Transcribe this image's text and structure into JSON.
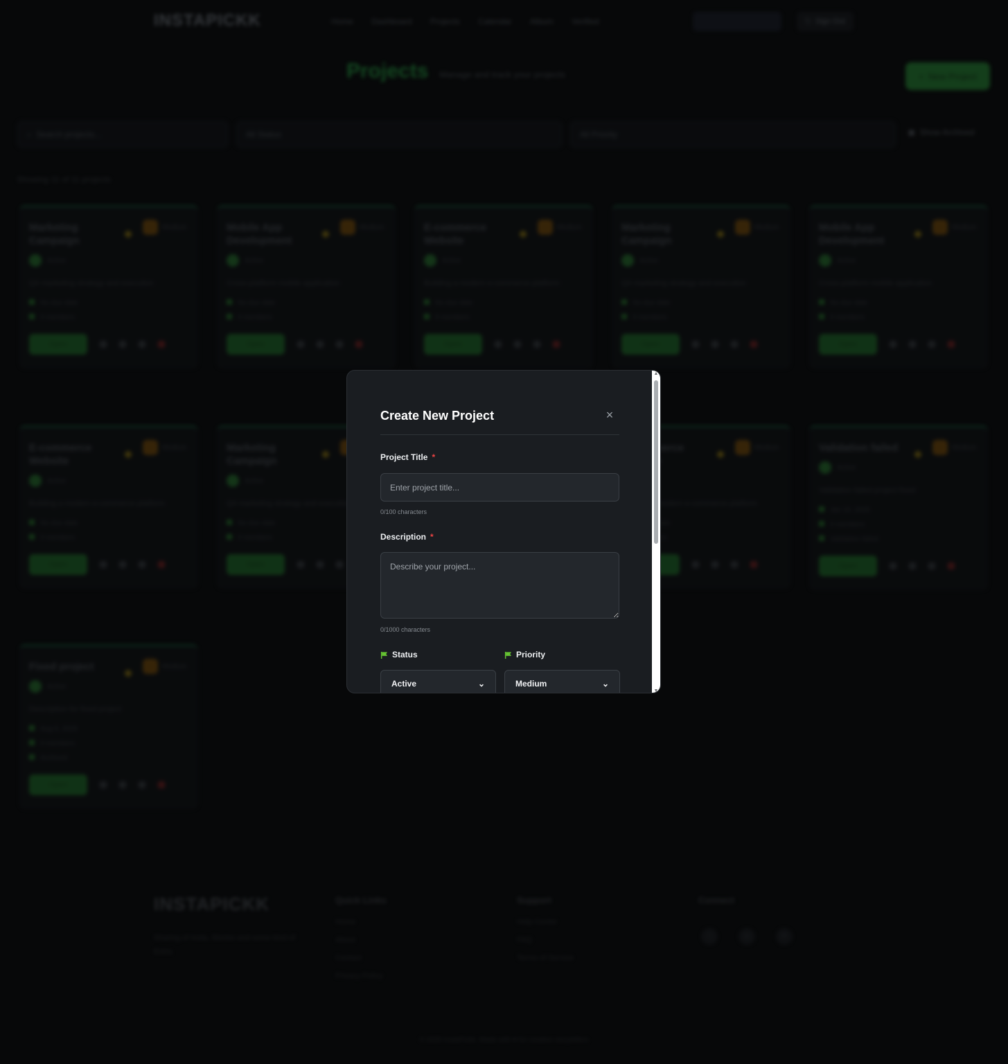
{
  "nav": {
    "logo": "INSTAPICKK",
    "links": [
      "Home",
      "Dashboard",
      "Projects",
      "Calendar",
      "Album",
      "Verified"
    ],
    "signout": "Sign Out"
  },
  "header": {
    "title": "Projects",
    "subtitle": "Manage and track your projects",
    "new_button": "New Project"
  },
  "filters": {
    "search_placeholder": "Search projects...",
    "status": "All Status",
    "priority": "All Priority",
    "archived": "Show Archived"
  },
  "showing": "Showing 11 of 11 projects",
  "cards": [
    {
      "title": "Marketing Campaign",
      "priority": "Medium",
      "status": "Active",
      "desc": "Q4 marketing strategy and execution",
      "meta": [
        "No due date",
        "0 members"
      ],
      "open": "Open"
    },
    {
      "title": "Mobile App Development",
      "priority": "Medium",
      "status": "Active",
      "desc": "Cross-platform mobile application",
      "meta": [
        "No due date",
        "0 members"
      ],
      "open": "Open"
    },
    {
      "title": "E-commerce Website",
      "priority": "Medium",
      "status": "Active",
      "desc": "Building a modern e-commerce platform",
      "meta": [
        "No due date",
        "0 members"
      ],
      "open": "Open"
    },
    {
      "title": "Marketing Campaign",
      "priority": "Medium",
      "status": "Active",
      "desc": "Q4 marketing strategy and execution",
      "meta": [
        "No due date",
        "0 members"
      ],
      "open": "Open"
    },
    {
      "title": "Mobile App Development",
      "priority": "Medium",
      "status": "Active",
      "desc": "Cross-platform mobile application",
      "meta": [
        "No due date",
        "0 members"
      ],
      "open": "Open"
    },
    {
      "title": "E-commerce Website",
      "priority": "Medium",
      "status": "Active",
      "desc": "Building a modern e-commerce platform",
      "meta": [
        "No due date",
        "0 members"
      ],
      "open": "Open"
    },
    {
      "title": "Marketing Campaign",
      "priority": "Medium",
      "status": "Active",
      "desc": "Q4 marketing strategy and execution",
      "meta": [
        "No due date",
        "0 members"
      ],
      "open": "Open"
    },
    {
      "title": "E-commerce Website",
      "priority": "Medium",
      "status": "Active",
      "desc": "Building a modern e-commerce platform",
      "meta": [
        "No due date",
        "0 members"
      ],
      "open": "Open"
    },
    {
      "title": "Validation failed",
      "priority": "Medium",
      "status": "Active",
      "desc": "Validation failed project fixed",
      "meta": [
        "Jan 10, 2025",
        "0 members",
        "Validation failed"
      ],
      "open": "Open"
    },
    {
      "title": "Fixed project",
      "priority": "Medium",
      "status": "Active",
      "desc": "Description for fixed project",
      "meta": [
        "Aug 5, 2025",
        "0 members",
        "Archived"
      ],
      "open": "Open"
    }
  ],
  "footer": {
    "logo": "INSTAPICKK",
    "tagline": "Sharing of Insta, Stories and some kind of Extra.",
    "quick_links_title": "Quick Links",
    "quick_links": [
      "Home",
      "About",
      "Contact",
      "Privacy Policy"
    ],
    "support_title": "Support",
    "support_links": [
      "Help Center",
      "FAQ",
      "Terms of Service"
    ],
    "connect_title": "Connect",
    "copyright": "© 2025 InstaPickk. Made with ♥ for creative storytellers"
  },
  "modal": {
    "title": "Create New Project",
    "close": "×",
    "title_label": "Project Title",
    "required_mark": "*",
    "title_placeholder": "Enter project title...",
    "title_count": "0/100 characters",
    "desc_label": "Description",
    "desc_placeholder": "Describe your project...",
    "desc_count": "0/1000 characters",
    "status_label": "Status",
    "status_value": "Active",
    "priority_label": "Priority",
    "priority_value": "Medium",
    "flag_color": "#65c232"
  }
}
